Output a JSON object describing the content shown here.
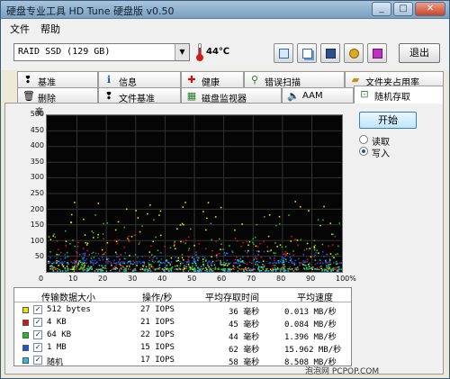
{
  "window": {
    "title": "硬盘专业工具 HD Tune 硬盘版 v0.50"
  },
  "menu": {
    "items": [
      "文件",
      "帮助"
    ]
  },
  "toolbar": {
    "drive": "RAID SSD (129 GB)",
    "temperature": "44℃",
    "exit_label": "退出",
    "tools": [
      "copy-info-icon",
      "copy-screenshot-icon",
      "save-icon",
      "options-icon",
      "download-icon"
    ]
  },
  "tabs_row1": [
    {
      "label": "基准",
      "icon": "benchmark-icon"
    },
    {
      "label": "信息",
      "icon": "info-icon"
    },
    {
      "label": "健康",
      "icon": "health-icon"
    },
    {
      "label": "错误扫描",
      "icon": "error-scan-icon"
    },
    {
      "label": "文件夹占用率",
      "icon": "folder-usage-icon"
    }
  ],
  "tabs_row2": [
    {
      "label": "删除",
      "icon": "erase-icon"
    },
    {
      "label": "文件基准",
      "icon": "file-benchmark-icon"
    },
    {
      "label": "磁盘监视器",
      "icon": "disk-monitor-icon"
    },
    {
      "label": "AAM",
      "icon": "aam-icon"
    },
    {
      "label": "随机存取",
      "icon": "random-access-icon"
    }
  ],
  "actions": {
    "start_label": "开始"
  },
  "mode": {
    "options": [
      "读取",
      "写入"
    ],
    "selected": "写入"
  },
  "chart_data": {
    "type": "scatter",
    "ylabel": "毫",
    "ylim": [
      0,
      500
    ],
    "xlim": [
      0,
      100
    ],
    "yticks": [
      "500",
      "450",
      "400",
      "350",
      "300",
      "250",
      "200",
      "150",
      "100",
      "50"
    ],
    "xticks": [
      "0",
      "10",
      "20",
      "30",
      "40",
      "50",
      "60",
      "70",
      "80",
      "90",
      "100%"
    ],
    "grid": true,
    "series": [
      {
        "name": "512 bytes",
        "color": "#e6e600",
        "band": [
          10,
          230
        ]
      },
      {
        "name": "4 KB",
        "color": "#e01010",
        "band": [
          10,
          120
        ]
      },
      {
        "name": "64 KB",
        "color": "#20c020",
        "band": [
          10,
          190
        ]
      },
      {
        "name": "1 MB",
        "color": "#2050e0",
        "band": [
          30,
          70
        ]
      },
      {
        "name": "随机",
        "color": "#20c0e0",
        "band": [
          5,
          40
        ]
      }
    ]
  },
  "results": {
    "headers": [
      "传输数据大小",
      "操作/秒",
      "平均存取时间",
      "平均速度"
    ],
    "rows": [
      {
        "color": "#e6e600",
        "size": "512 bytes",
        "ops": "27 IOPS",
        "access": "36 毫秒",
        "speed": "0.013 MB/秒"
      },
      {
        "color": "#e01010",
        "size": "4 KB",
        "ops": "21 IOPS",
        "access": "45 毫秒",
        "speed": "0.084 MB/秒"
      },
      {
        "color": "#20c020",
        "size": "64 KB",
        "ops": "22 IOPS",
        "access": "44 毫秒",
        "speed": "1.396 MB/秒"
      },
      {
        "color": "#2050e0",
        "size": "1 MB",
        "ops": "15 IOPS",
        "access": "62 毫秒",
        "speed": "15.962 MB/秒"
      },
      {
        "color": "#20c0e0",
        "size": "随机",
        "ops": "17 IOPS",
        "access": "58 毫秒",
        "speed": "8.508 MB/秒"
      }
    ]
  },
  "watermark": "泡泡网 PCPOP.COM"
}
